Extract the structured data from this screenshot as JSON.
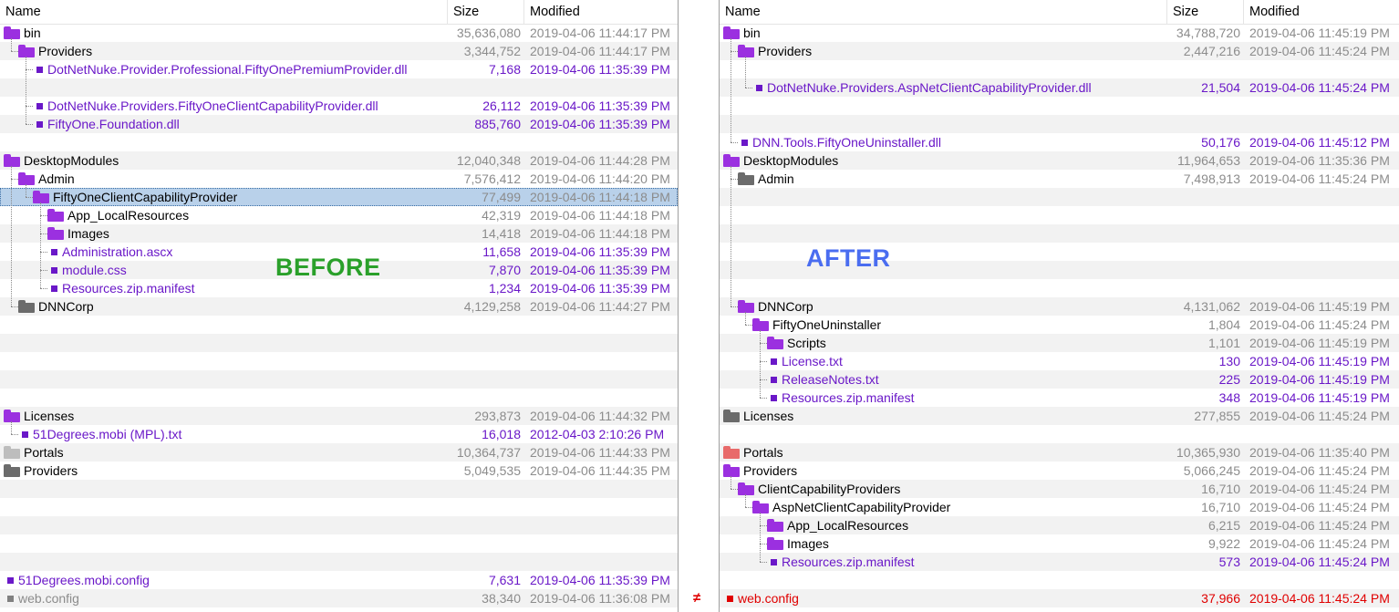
{
  "columns": {
    "name": "Name",
    "size": "Size",
    "modified": "Modified"
  },
  "colors": {
    "folder_purple": "#9b30e0",
    "folder_gray": "#6b6b6b",
    "folder_light": "#bdbdbd",
    "folder_red": "#e86a6a",
    "file_purple": "#6a18c8",
    "diff_red": "#e00000",
    "selection": "#b9d1ea",
    "before_label": "#2aa02a",
    "after_label": "#4a6df0"
  },
  "labels": {
    "before": "BEFORE",
    "after": "AFTER"
  },
  "gutter_marks": [
    {
      "row": 31,
      "symbol": "≠"
    }
  ],
  "left_rows": [
    {
      "name": "bin",
      "size": "35,636,080",
      "modified": "2019-04-06 11:44:17 PM",
      "depth": 0,
      "type": "folder",
      "folder": "purple",
      "color": "black",
      "meta": "gray"
    },
    {
      "name": "Providers",
      "size": "3,344,752",
      "modified": "2019-04-06 11:44:17 PM",
      "depth": 1,
      "type": "folder",
      "folder": "purple",
      "color": "black",
      "meta": "gray"
    },
    {
      "name": "DotNetNuke.Provider.Professional.FiftyOnePremiumProvider.dll",
      "size": "7,168",
      "modified": "2019-04-06 11:35:39 PM",
      "depth": 2,
      "type": "file",
      "color": "purple",
      "meta": "purple"
    },
    {
      "type": "blank"
    },
    {
      "name": "DotNetNuke.Providers.FiftyOneClientCapabilityProvider.dll",
      "size": "26,112",
      "modified": "2019-04-06 11:35:39 PM",
      "depth": 2,
      "type": "file",
      "color": "purple",
      "meta": "purple"
    },
    {
      "name": "FiftyOne.Foundation.dll",
      "size": "885,760",
      "modified": "2019-04-06 11:35:39 PM",
      "depth": 2,
      "type": "file",
      "color": "purple",
      "meta": "purple"
    },
    {
      "type": "blank"
    },
    {
      "name": "DesktopModules",
      "size": "12,040,348",
      "modified": "2019-04-06 11:44:28 PM",
      "depth": 0,
      "type": "folder",
      "folder": "purple",
      "color": "black",
      "meta": "gray"
    },
    {
      "name": "Admin",
      "size": "7,576,412",
      "modified": "2019-04-06 11:44:20 PM",
      "depth": 1,
      "type": "folder",
      "folder": "purple",
      "color": "black",
      "meta": "gray"
    },
    {
      "name": "FiftyOneClientCapabilityProvider",
      "size": "77,499",
      "modified": "2019-04-06 11:44:18 PM",
      "depth": 2,
      "type": "folder",
      "folder": "purple",
      "color": "black",
      "meta": "gray",
      "selected": true
    },
    {
      "name": "App_LocalResources",
      "size": "42,319",
      "modified": "2019-04-06 11:44:18 PM",
      "depth": 3,
      "type": "folder",
      "folder": "purple",
      "color": "black",
      "meta": "gray"
    },
    {
      "name": "Images",
      "size": "14,418",
      "modified": "2019-04-06 11:44:18 PM",
      "depth": 3,
      "type": "folder",
      "folder": "purple",
      "color": "black",
      "meta": "gray"
    },
    {
      "name": "Administration.ascx",
      "size": "11,658",
      "modified": "2019-04-06 11:35:39 PM",
      "depth": 3,
      "type": "file",
      "color": "purple",
      "meta": "purple"
    },
    {
      "name": "module.css",
      "size": "7,870",
      "modified": "2019-04-06 11:35:39 PM",
      "depth": 3,
      "type": "file",
      "color": "purple",
      "meta": "purple"
    },
    {
      "name": "Resources.zip.manifest",
      "size": "1,234",
      "modified": "2019-04-06 11:35:39 PM",
      "depth": 3,
      "type": "file",
      "color": "purple",
      "meta": "purple"
    },
    {
      "name": "DNNCorp",
      "size": "4,129,258",
      "modified": "2019-04-06 11:44:27 PM",
      "depth": 1,
      "type": "folder",
      "folder": "gray",
      "color": "black",
      "meta": "gray"
    },
    {
      "type": "blank"
    },
    {
      "type": "blank"
    },
    {
      "type": "blank"
    },
    {
      "type": "blank"
    },
    {
      "type": "blank"
    },
    {
      "name": "Licenses",
      "size": "293,873",
      "modified": "2019-04-06 11:44:32 PM",
      "depth": 0,
      "type": "folder",
      "folder": "purple",
      "color": "black",
      "meta": "gray"
    },
    {
      "name": "51Degrees.mobi (MPL).txt",
      "size": "16,018",
      "modified": "2012-04-03 2:10:26 PM",
      "depth": 1,
      "type": "file",
      "color": "purple",
      "meta": "purple"
    },
    {
      "name": "Portals",
      "size": "10,364,737",
      "modified": "2019-04-06 11:44:33 PM",
      "depth": 0,
      "type": "folder",
      "folder": "light",
      "color": "black",
      "meta": "gray"
    },
    {
      "name": "Providers",
      "size": "5,049,535",
      "modified": "2019-04-06 11:44:35 PM",
      "depth": 0,
      "type": "folder",
      "folder": "gray",
      "color": "black",
      "meta": "gray"
    },
    {
      "type": "blank"
    },
    {
      "type": "blank"
    },
    {
      "type": "blank"
    },
    {
      "type": "blank"
    },
    {
      "type": "blank"
    },
    {
      "name": "51Degrees.mobi.config",
      "size": "7,631",
      "modified": "2019-04-06 11:35:39 PM",
      "depth": 0,
      "type": "file",
      "color": "purple",
      "meta": "purple"
    },
    {
      "name": "web.config",
      "size": "38,340",
      "modified": "2019-04-06 11:36:08 PM",
      "depth": 0,
      "type": "file",
      "sq": "gray",
      "color": "gray",
      "meta": "gray"
    }
  ],
  "right_rows": [
    {
      "name": "bin",
      "size": "34,788,720",
      "modified": "2019-04-06 11:45:19 PM",
      "depth": 0,
      "type": "folder",
      "folder": "purple",
      "color": "black",
      "meta": "gray"
    },
    {
      "name": "Providers",
      "size": "2,447,216",
      "modified": "2019-04-06 11:45:24 PM",
      "depth": 1,
      "type": "folder",
      "folder": "purple",
      "color": "black",
      "meta": "gray"
    },
    {
      "type": "blank"
    },
    {
      "name": "DotNetNuke.Providers.AspNetClientCapabilityProvider.dll",
      "size": "21,504",
      "modified": "2019-04-06 11:45:24 PM",
      "depth": 2,
      "type": "file",
      "color": "purple",
      "meta": "purple"
    },
    {
      "type": "blank"
    },
    {
      "type": "blank"
    },
    {
      "name": "DNN.Tools.FiftyOneUninstaller.dll",
      "size": "50,176",
      "modified": "2019-04-06 11:45:12 PM",
      "depth": 1,
      "type": "file",
      "color": "purple",
      "meta": "purple"
    },
    {
      "name": "DesktopModules",
      "size": "11,964,653",
      "modified": "2019-04-06 11:35:36 PM",
      "depth": 0,
      "type": "folder",
      "folder": "purple",
      "color": "black",
      "meta": "gray"
    },
    {
      "name": "Admin",
      "size": "7,498,913",
      "modified": "2019-04-06 11:45:24 PM",
      "depth": 1,
      "type": "folder",
      "folder": "gray",
      "color": "black",
      "meta": "gray"
    },
    {
      "type": "blank"
    },
    {
      "type": "blank"
    },
    {
      "type": "blank"
    },
    {
      "type": "blank"
    },
    {
      "type": "blank"
    },
    {
      "type": "blank"
    },
    {
      "name": "DNNCorp",
      "size": "4,131,062",
      "modified": "2019-04-06 11:45:19 PM",
      "depth": 1,
      "type": "folder",
      "folder": "purple",
      "color": "black",
      "meta": "gray"
    },
    {
      "name": "FiftyOneUninstaller",
      "size": "1,804",
      "modified": "2019-04-06 11:45:24 PM",
      "depth": 2,
      "type": "folder",
      "folder": "purple",
      "color": "black",
      "meta": "gray"
    },
    {
      "name": "Scripts",
      "size": "1,101",
      "modified": "2019-04-06 11:45:19 PM",
      "depth": 3,
      "type": "folder",
      "folder": "purple",
      "color": "black",
      "meta": "gray"
    },
    {
      "name": "License.txt",
      "size": "130",
      "modified": "2019-04-06 11:45:19 PM",
      "depth": 3,
      "type": "file",
      "color": "purple",
      "meta": "purple"
    },
    {
      "name": "ReleaseNotes.txt",
      "size": "225",
      "modified": "2019-04-06 11:45:19 PM",
      "depth": 3,
      "type": "file",
      "color": "purple",
      "meta": "purple"
    },
    {
      "name": "Resources.zip.manifest",
      "size": "348",
      "modified": "2019-04-06 11:45:19 PM",
      "depth": 3,
      "type": "file",
      "color": "purple",
      "meta": "purple"
    },
    {
      "name": "Licenses",
      "size": "277,855",
      "modified": "2019-04-06 11:45:24 PM",
      "depth": 0,
      "type": "folder",
      "folder": "gray",
      "color": "black",
      "meta": "gray"
    },
    {
      "type": "blank"
    },
    {
      "name": "Portals",
      "size": "10,365,930",
      "modified": "2019-04-06 11:35:40 PM",
      "depth": 0,
      "type": "folder",
      "folder": "red",
      "color": "black",
      "meta": "gray"
    },
    {
      "name": "Providers",
      "size": "5,066,245",
      "modified": "2019-04-06 11:45:24 PM",
      "depth": 0,
      "type": "folder",
      "folder": "purple",
      "color": "black",
      "meta": "gray"
    },
    {
      "name": "ClientCapabilityProviders",
      "size": "16,710",
      "modified": "2019-04-06 11:45:24 PM",
      "depth": 1,
      "type": "folder",
      "folder": "purple",
      "color": "black",
      "meta": "gray"
    },
    {
      "name": "AspNetClientCapabilityProvider",
      "size": "16,710",
      "modified": "2019-04-06 11:45:24 PM",
      "depth": 2,
      "type": "folder",
      "folder": "purple",
      "color": "black",
      "meta": "gray"
    },
    {
      "name": "App_LocalResources",
      "size": "6,215",
      "modified": "2019-04-06 11:45:24 PM",
      "depth": 3,
      "type": "folder",
      "folder": "purple",
      "color": "black",
      "meta": "gray"
    },
    {
      "name": "Images",
      "size": "9,922",
      "modified": "2019-04-06 11:45:24 PM",
      "depth": 3,
      "type": "folder",
      "folder": "purple",
      "color": "black",
      "meta": "gray"
    },
    {
      "name": "Resources.zip.manifest",
      "size": "573",
      "modified": "2019-04-06 11:45:24 PM",
      "depth": 3,
      "type": "file",
      "color": "purple",
      "meta": "purple"
    },
    {
      "type": "blank"
    },
    {
      "name": "web.config",
      "size": "37,966",
      "modified": "2019-04-06 11:45:24 PM",
      "depth": 0,
      "type": "file",
      "sq": "red",
      "color": "red",
      "meta": "red"
    }
  ]
}
